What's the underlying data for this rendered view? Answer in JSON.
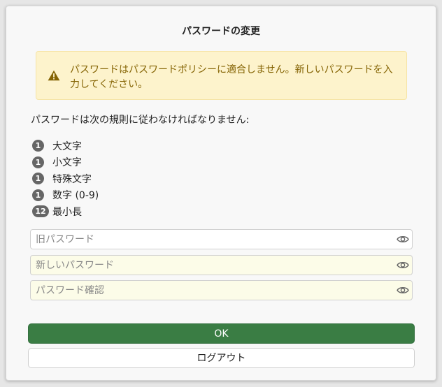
{
  "dialog": {
    "title": "パスワードの変更"
  },
  "alert": {
    "icon": "warning-triangle-icon",
    "color": "#856404",
    "background": "#fdf3cc",
    "message": "パスワードはパスワードポリシーに適合しません。新しいパスワードを入力してください。"
  },
  "rules": {
    "heading": "パスワードは次の規則に従わなければなりません:",
    "items": [
      {
        "count": "1",
        "label": "大文字"
      },
      {
        "count": "1",
        "label": "小文字"
      },
      {
        "count": "1",
        "label": "特殊文字"
      },
      {
        "count": "1",
        "label": "数字 (0-9)"
      },
      {
        "count": "12",
        "label": "最小長"
      }
    ]
  },
  "fields": {
    "old_password": {
      "placeholder": "旧パスワード",
      "value": ""
    },
    "new_password": {
      "placeholder": "新しいパスワード",
      "value": ""
    },
    "confirm_password": {
      "placeholder": "パスワード確認",
      "value": ""
    }
  },
  "buttons": {
    "ok_label": "OK",
    "logout_label": "ログアウト",
    "ok_color": "#3a7d44"
  }
}
